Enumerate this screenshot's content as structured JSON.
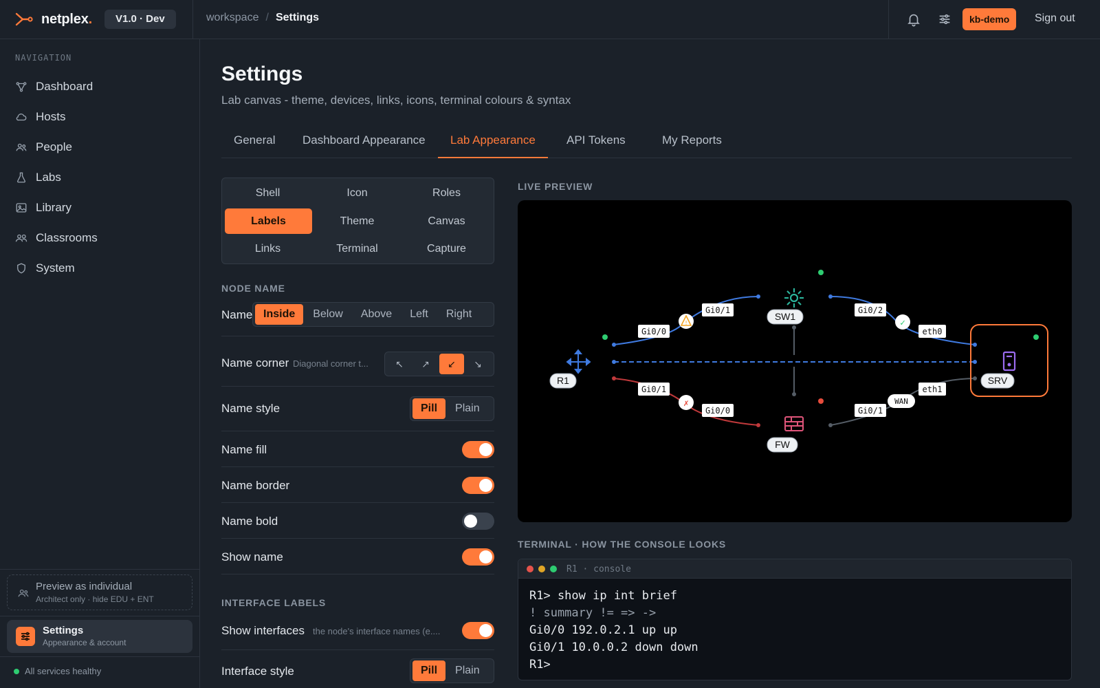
{
  "header": {
    "brand": "netplex",
    "brand_dot": ".",
    "version": "V1.0 · Dev",
    "breadcrumb_root": "workspace",
    "breadcrumb_sep": "/",
    "breadcrumb_current": "Settings",
    "account": "kb-demo",
    "signout": "Sign out"
  },
  "sidebar": {
    "heading": "NAVIGATION",
    "items": [
      {
        "label": "Dashboard",
        "icon": "topology-icon"
      },
      {
        "label": "Hosts",
        "icon": "cloud-icon"
      },
      {
        "label": "People",
        "icon": "people-icon"
      },
      {
        "label": "Labs",
        "icon": "flask-icon"
      },
      {
        "label": "Library",
        "icon": "image-icon"
      },
      {
        "label": "Classrooms",
        "icon": "classroom-icon"
      },
      {
        "label": "System",
        "icon": "shield-icon"
      }
    ],
    "preview": {
      "title": "Preview as individual",
      "sub": "Architect only · hide EDU + ENT"
    },
    "settings_card": {
      "title": "Settings",
      "sub": "Appearance & account"
    },
    "health": "All services healthy"
  },
  "page": {
    "title": "Settings",
    "subtitle": "Lab canvas - theme, devices, links, icons, terminal colours & syntax",
    "tabs": [
      "General",
      "Dashboard Appearance",
      "Lab Appearance",
      "API Tokens",
      "My Reports"
    ],
    "active_tab": "Lab Appearance"
  },
  "subnav": {
    "items": [
      "Shell",
      "Icon",
      "Roles",
      "Labels",
      "Theme",
      "Canvas",
      "Links",
      "Terminal",
      "Capture"
    ],
    "active": "Labels"
  },
  "node_name": {
    "heading": "NODE NAME",
    "name_label": "Name",
    "name_options": [
      "Inside",
      "Below",
      "Above",
      "Left",
      "Right"
    ],
    "name_selected": "Inside",
    "corner_label": "Name corner",
    "corner_hint": "Diagonal corner t...",
    "corner_options": [
      "↖",
      "↗",
      "↙",
      "↘"
    ],
    "corner_selected": "↙",
    "style_label": "Name style",
    "style_options": [
      "Pill",
      "Plain"
    ],
    "style_selected": "Pill",
    "fill_label": "Name fill",
    "fill_on": true,
    "border_label": "Name border",
    "border_on": true,
    "bold_label": "Name bold",
    "bold_on": false,
    "show_label": "Show name",
    "show_on": true
  },
  "interface_labels": {
    "heading": "INTERFACE LABELS",
    "show_label": "Show interfaces",
    "show_hint": "the node's interface names (e....",
    "show_on": true,
    "style_label": "Interface style",
    "style_options": [
      "Pill",
      "Plain"
    ],
    "style_selected": "Pill"
  },
  "preview": {
    "heading": "LIVE PREVIEW",
    "nodes": [
      "R1",
      "SW1",
      "FW",
      "SRV"
    ],
    "interface_tags": [
      "Gi0/0",
      "Gi0/1",
      "Gi0/2",
      "eth0",
      "Gi0/1",
      "Gi0/0",
      "Gi0/1",
      "eth1"
    ],
    "link_tag": "WAN",
    "status_marks": [
      "!",
      "✓",
      "✗"
    ],
    "colors": {
      "blue_link": "#3f7ae0",
      "red_link": "#c0393b",
      "grey_link": "#555d66",
      "accent": "#ff7a3a",
      "switch": "#2bb39a",
      "firewall": "#e0557a",
      "server": "#9b6cf0"
    }
  },
  "terminal": {
    "heading": "TERMINAL · HOW THE CONSOLE LOOKS",
    "title": "R1 · console",
    "lines": [
      "R1> show ip int brief",
      "! summary != => ->",
      "Gi0/0 192.0.2.1 up up",
      "Gi0/1 10.0.0.2 down down",
      "R1>"
    ]
  },
  "theme": {
    "accent": "#ff7a3a",
    "bg": "#1b2129",
    "panel": "#232a33",
    "border": "#2c333d"
  }
}
